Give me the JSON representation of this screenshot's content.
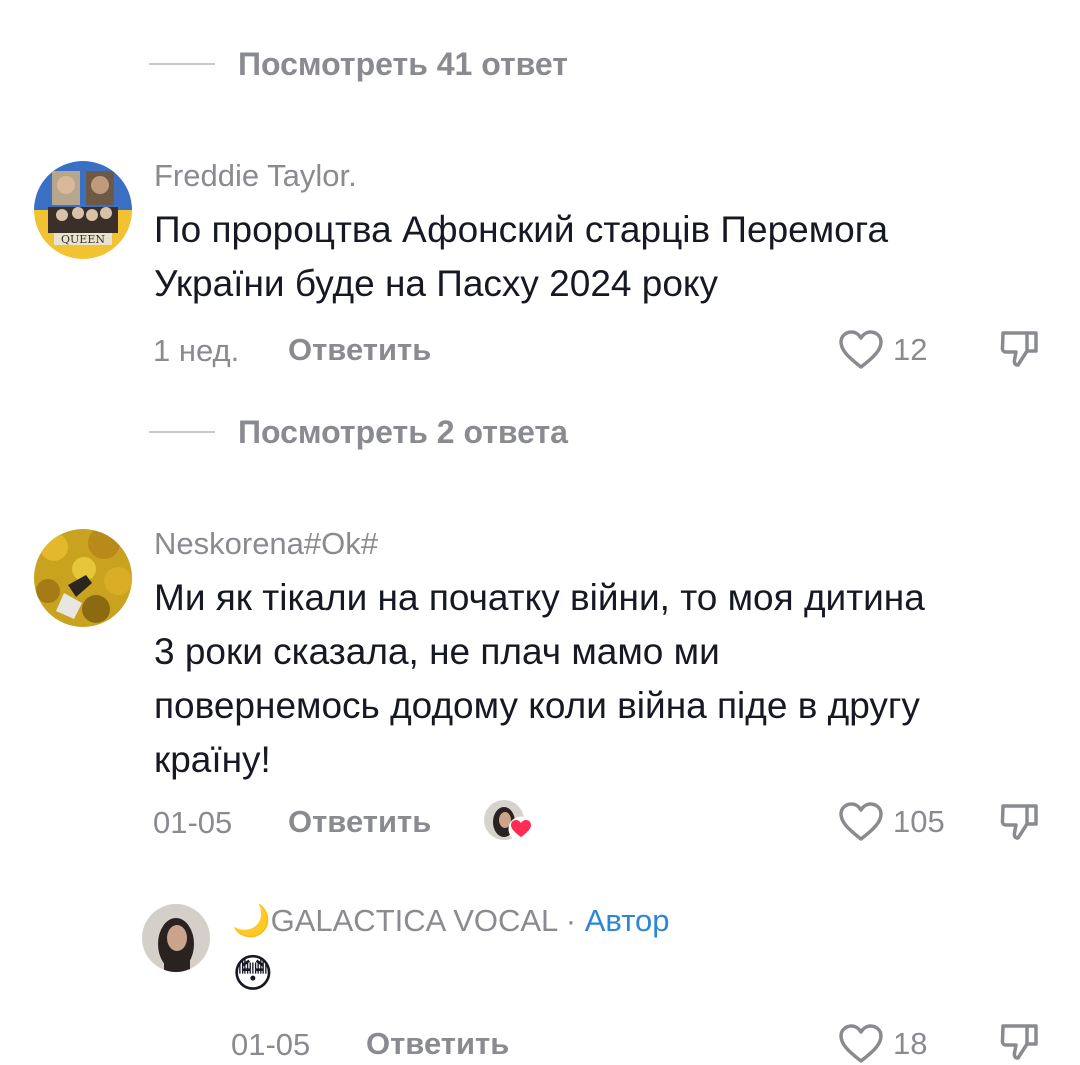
{
  "view_replies_1": "Посмотреть 41 ответ",
  "view_replies_2": "Посмотреть 2 ответа",
  "comments": [
    {
      "username": "Freddie Taylor.",
      "avatar_icon": "queen-band-avatar",
      "text_lines": [
        "По пророцтва Афонский старців Перемога",
        "України буде на Пасху 2024 року"
      ],
      "date": "1 нед.",
      "reply_label": "Ответить",
      "likes": "12"
    },
    {
      "username": "Neskorena#Ok#",
      "avatar_icon": "autumn-leaves-avatar",
      "text_lines": [
        "Ми як тікали на початку війни, то моя дитина",
        "3 роки сказала, не плач мамо ми",
        "повернемось додому коли війна піде в другу",
        "країну!"
      ],
      "date": "01-05",
      "reply_label": "Ответить",
      "likes": "105"
    },
    {
      "username": "🌙GALACTICA VOCAL",
      "separator": "·",
      "author_label": "Автор",
      "avatar_icon": "creator-avatar",
      "text": "😳",
      "date": "01-05",
      "reply_label": "Ответить",
      "likes": "18"
    }
  ],
  "colors": {
    "text": "#161823",
    "muted": "#8a8b91",
    "author": "#2e86d6",
    "heart_badge": "#fe2c55"
  }
}
